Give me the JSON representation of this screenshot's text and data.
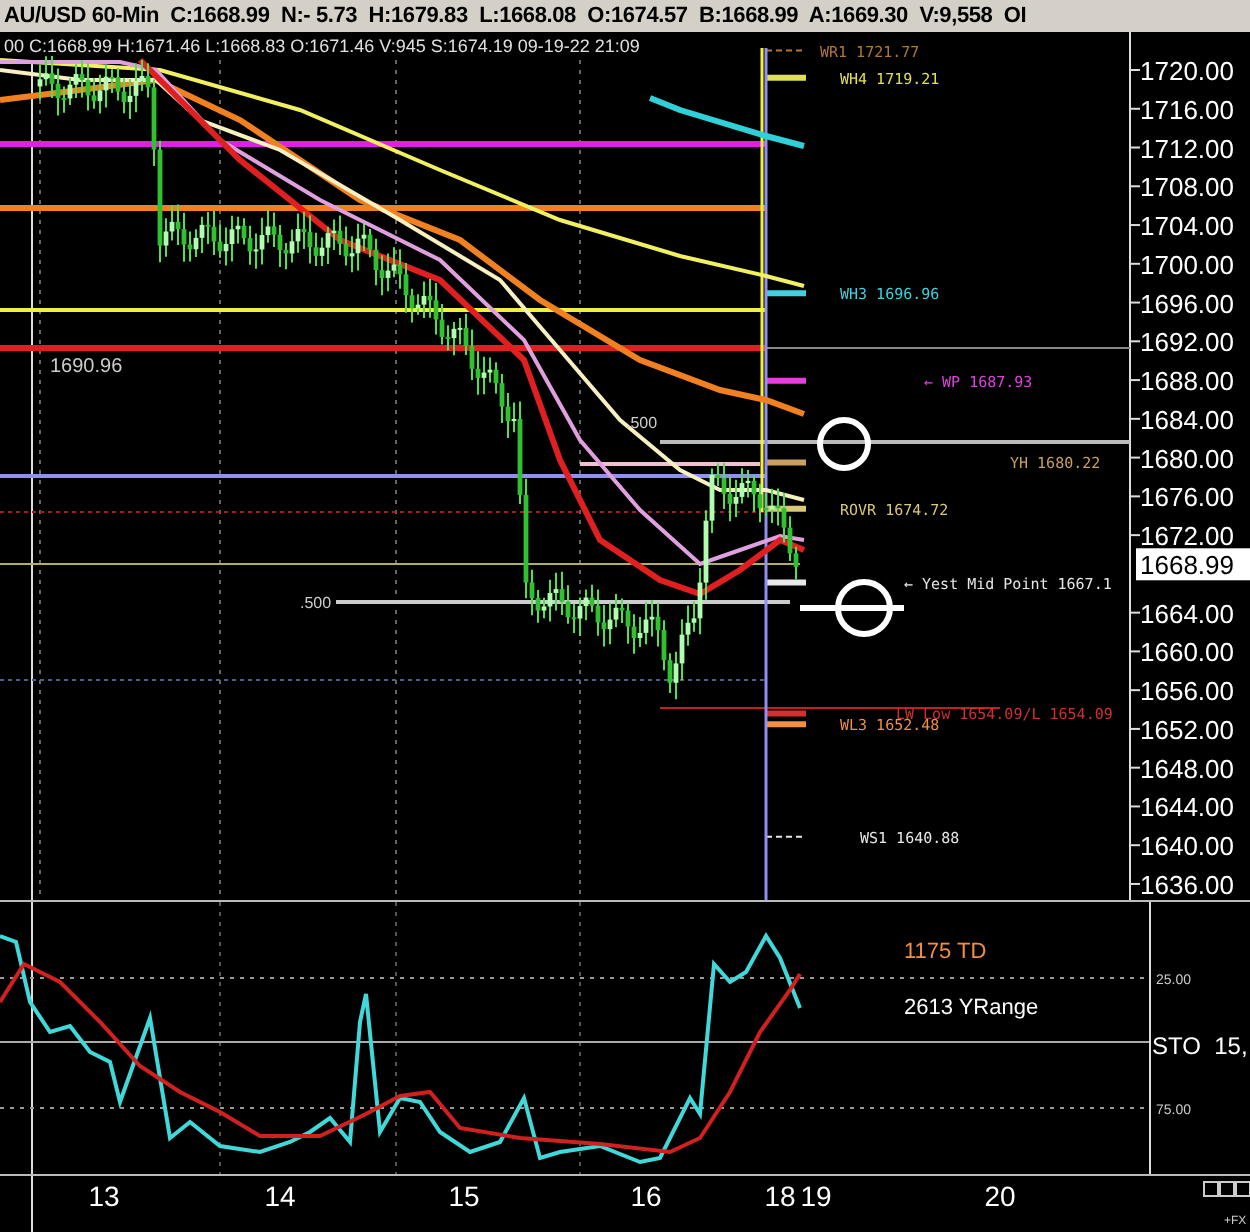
{
  "header": {
    "quote": "AU/USD 60-Min  C:1668.99  N:- 5.73  H:1679.83  L:1668.08  O:1674.57  B:1668.99  A:1669.30  V:9,558  OI",
    "bar": "00 C:1668.99 H:1671.46 L:1668.83 O:1671.46 V:945 S:1674.19 09-19-22 21:09"
  },
  "price_pane": {
    "axis_labels": [
      "1720.00",
      "1716.00",
      "1712.00",
      "1708.00",
      "1704.00",
      "1700.00",
      "1696.00",
      "1692.00",
      "1688.00",
      "1684.00",
      "1680.00",
      "1676.00",
      "1672.00",
      "1664.00",
      "1660.00",
      "1656.00",
      "1652.00",
      "1648.00",
      "1644.00",
      "1640.00",
      "1636.00"
    ],
    "current_price": "1668.99",
    "left_label": "1690.96",
    "fib_labels": [
      ".500",
      ".500"
    ],
    "levels": [
      {
        "label": "WR1 1721.77",
        "color": "#b07838"
      },
      {
        "label": "WH4 1719.21",
        "color": "#e0e050"
      },
      {
        "label": "WH3 1696.96",
        "color": "#40d0e0"
      },
      {
        "label": "← WP 1687.93",
        "color": "#e040e0"
      },
      {
        "label": "YH 1680.22",
        "color": "#c8a060"
      },
      {
        "label": "ROVR 1674.72",
        "color": "#d8c878"
      },
      {
        "label": "← Yest Mid Point 1667.1",
        "color": "#e8e8e8"
      },
      {
        "label": "LW Low 1654.09/L 1654.09",
        "color": "#d03030"
      },
      {
        "label": "WL3 1652.48",
        "color": "#f09040"
      },
      {
        "label": "WS1 1640.88",
        "color": "#e8e8e8"
      }
    ]
  },
  "stochastic_pane": {
    "title": "STO  15,",
    "axis_labels": [
      "25.00",
      "75.00"
    ],
    "stats": [
      {
        "label": "1175 TD",
        "color": "#f09040"
      },
      {
        "label": "2613 YRange",
        "color": "#ffffff"
      }
    ]
  },
  "x_axis": [
    "13",
    "14",
    "15",
    "16",
    "18",
    "19",
    "20"
  ],
  "corner_label": "+FX"
}
